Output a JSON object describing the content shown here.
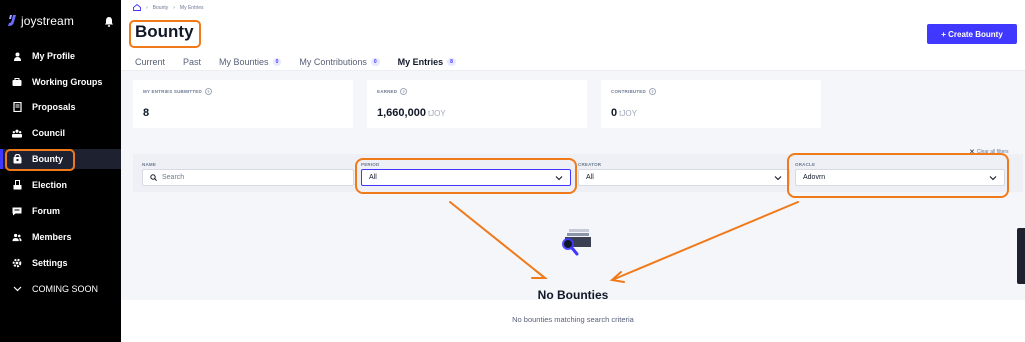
{
  "brand": {
    "name": "joystream"
  },
  "sidebar": {
    "items": [
      {
        "label": "My Profile",
        "icon": "user-icon"
      },
      {
        "label": "Working Groups",
        "icon": "briefcase-icon"
      },
      {
        "label": "Proposals",
        "icon": "document-icon"
      },
      {
        "label": "Council",
        "icon": "council-icon"
      },
      {
        "label": "Bounty",
        "icon": "bounty-icon",
        "active": true
      },
      {
        "label": "Election",
        "icon": "election-icon"
      },
      {
        "label": "Forum",
        "icon": "forum-icon"
      },
      {
        "label": "Members",
        "icon": "members-icon"
      },
      {
        "label": "Settings",
        "icon": "gear-icon"
      },
      {
        "label": "COMING SOON",
        "icon": "chevron-down-icon"
      }
    ]
  },
  "breadcrumb": {
    "items": [
      "Bounty",
      "My Entries"
    ]
  },
  "page": {
    "title": "Bounty",
    "create_label": "+ Create Bounty"
  },
  "tabs": [
    {
      "label": "Current"
    },
    {
      "label": "Past"
    },
    {
      "label": "My Bounties",
      "count": "0"
    },
    {
      "label": "My Contributions",
      "count": "0"
    },
    {
      "label": "My Entries",
      "count": "8",
      "active": true
    }
  ],
  "stats": [
    {
      "label": "MY ENTRIES SUBMITTED",
      "value": "8",
      "unit": ""
    },
    {
      "label": "EARNED",
      "value": "1,660,000",
      "unit": "tJOY"
    },
    {
      "label": "CONTRIBUTED",
      "value": "0",
      "unit": "tJOY"
    }
  ],
  "filters": {
    "clear_label": "Clear all filters",
    "name": {
      "label": "NAME",
      "placeholder": "Search"
    },
    "period": {
      "label": "PERIOD",
      "value": "All"
    },
    "creator": {
      "label": "CREATOR",
      "value": "All"
    },
    "oracle": {
      "label": "ORACLE",
      "value": "Adovrn"
    }
  },
  "empty_state": {
    "title": "No Bounties",
    "subtitle": "No bounties matching search criteria"
  },
  "colors": {
    "accent": "#4038ff",
    "annotation": "#f07a1a",
    "sidebar_bg": "#000000"
  }
}
